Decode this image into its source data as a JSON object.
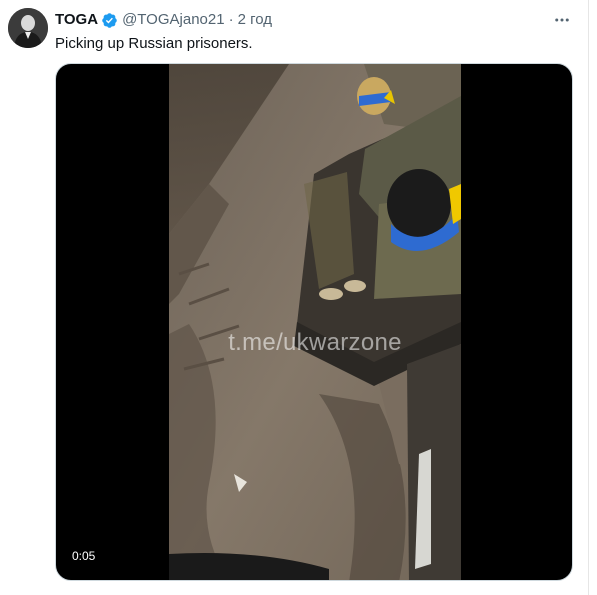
{
  "tweet": {
    "author_name": "TOGA",
    "handle": "@TOGAjano21",
    "separator": "·",
    "time": "2 год",
    "text": "Picking up Russian prisoners."
  },
  "media": {
    "watermark": "t.me/ukwarzone",
    "duration": "0:05"
  },
  "icons": {
    "verified": "verified-badge-icon",
    "more": "more-options-icon",
    "avatar": "avatar"
  },
  "colors": {
    "verified_blue": "#1d9bf0",
    "text_primary": "#0f1419",
    "text_secondary": "#536471"
  }
}
